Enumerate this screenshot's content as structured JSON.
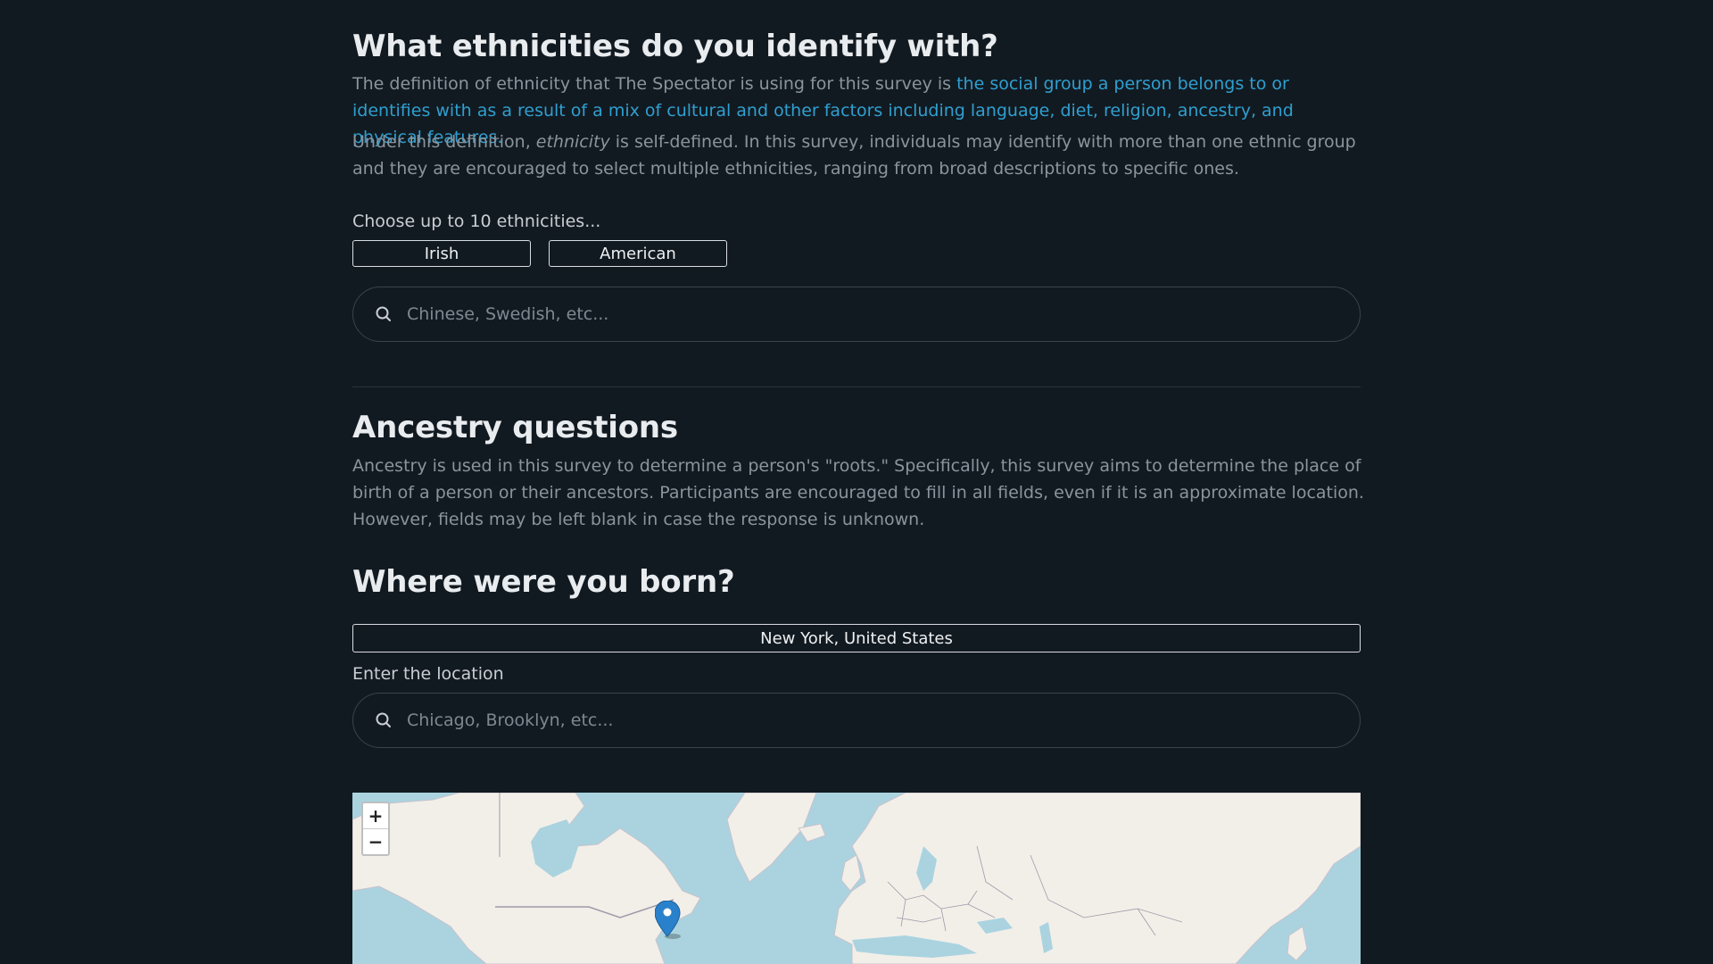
{
  "ethnicity": {
    "title": "What ethnicities do you identify with?",
    "def_prefix": "The definition of ethnicity that The Spectator is using for this survey is ",
    "def_link": "the social group a person belongs to or identifies with as a result of a mix of cultural and other factors including language, diet, religion, ancestry, and physical features.",
    "under_prefix": "Under this definition, ",
    "under_em": "ethnicity",
    "under_suffix": " is self-defined. In this survey, individuals may identify with more than one ethnic group and they are encouraged to select multiple ethnicities, ranging from broad descriptions to specific ones.",
    "choose_label": "Choose up to 10 ethnicities...",
    "chips": [
      "Irish",
      "American"
    ],
    "search_placeholder": "Chinese, Swedish, etc..."
  },
  "ancestry": {
    "title": "Ancestry questions",
    "description": "Ancestry is used in this survey to determine a person's \"roots.\" Specifically, this survey aims to determine the place of birth of a person or their ancestors. Participants are encouraged to fill in all fields, even if it is an approximate location. However, fields may be left blank in case the response is unknown."
  },
  "birthplace": {
    "title": "Where were you born?",
    "selected_location": "New York, United States",
    "enter_label": "Enter the location",
    "search_placeholder": "Chicago, Brooklyn, etc..."
  },
  "map": {
    "zoom_in": "+",
    "zoom_out": "−",
    "marker_icon": "map-pin-icon",
    "colors": {
      "water": "#aad3df",
      "land": "#f2efe9",
      "border": "#9e9aa8",
      "marker": "#2a81cb"
    }
  },
  "colors": {
    "background": "#121a21",
    "link": "#2f9fd0",
    "body_text": "#8b949c"
  }
}
